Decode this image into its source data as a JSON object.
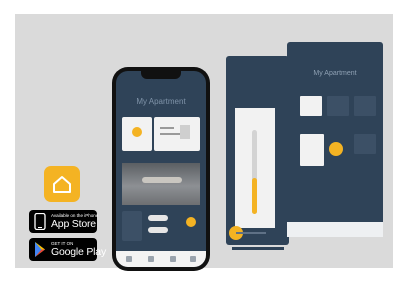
{
  "app": {
    "icon_name": "home-icon",
    "brand_color": "#f4b323"
  },
  "badges": {
    "app_store": {
      "small": "Available on the iPhone",
      "large": "App Store"
    },
    "google_play": {
      "small": "GET IT ON",
      "large": "Google Play"
    }
  },
  "phone": {
    "title": "My Apartment"
  },
  "tablet": {
    "title": "My Apartment"
  }
}
